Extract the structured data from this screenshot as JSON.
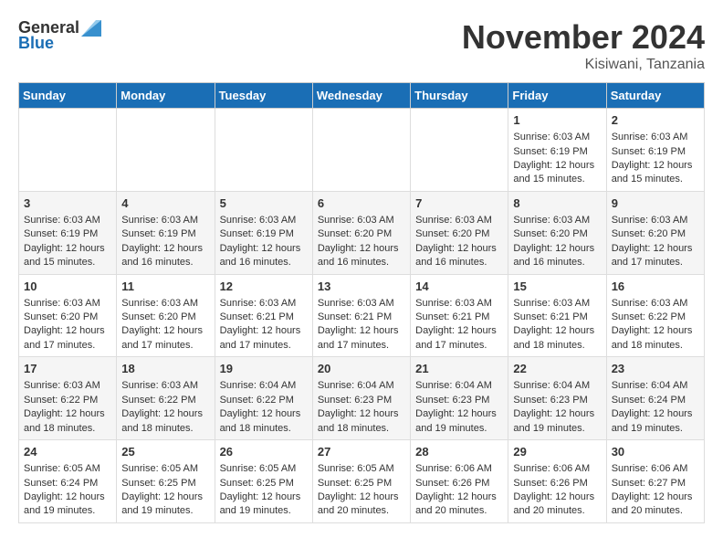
{
  "header": {
    "logo_general": "General",
    "logo_blue": "Blue",
    "month": "November 2024",
    "location": "Kisiwani, Tanzania"
  },
  "calendar": {
    "days_of_week": [
      "Sunday",
      "Monday",
      "Tuesday",
      "Wednesday",
      "Thursday",
      "Friday",
      "Saturday"
    ],
    "weeks": [
      [
        {
          "day": "",
          "info": ""
        },
        {
          "day": "",
          "info": ""
        },
        {
          "day": "",
          "info": ""
        },
        {
          "day": "",
          "info": ""
        },
        {
          "day": "",
          "info": ""
        },
        {
          "day": "1",
          "info": "Sunrise: 6:03 AM\nSunset: 6:19 PM\nDaylight: 12 hours\nand 15 minutes."
        },
        {
          "day": "2",
          "info": "Sunrise: 6:03 AM\nSunset: 6:19 PM\nDaylight: 12 hours\nand 15 minutes."
        }
      ],
      [
        {
          "day": "3",
          "info": "Sunrise: 6:03 AM\nSunset: 6:19 PM\nDaylight: 12 hours\nand 15 minutes."
        },
        {
          "day": "4",
          "info": "Sunrise: 6:03 AM\nSunset: 6:19 PM\nDaylight: 12 hours\nand 16 minutes."
        },
        {
          "day": "5",
          "info": "Sunrise: 6:03 AM\nSunset: 6:19 PM\nDaylight: 12 hours\nand 16 minutes."
        },
        {
          "day": "6",
          "info": "Sunrise: 6:03 AM\nSunset: 6:20 PM\nDaylight: 12 hours\nand 16 minutes."
        },
        {
          "day": "7",
          "info": "Sunrise: 6:03 AM\nSunset: 6:20 PM\nDaylight: 12 hours\nand 16 minutes."
        },
        {
          "day": "8",
          "info": "Sunrise: 6:03 AM\nSunset: 6:20 PM\nDaylight: 12 hours\nand 16 minutes."
        },
        {
          "day": "9",
          "info": "Sunrise: 6:03 AM\nSunset: 6:20 PM\nDaylight: 12 hours\nand 17 minutes."
        }
      ],
      [
        {
          "day": "10",
          "info": "Sunrise: 6:03 AM\nSunset: 6:20 PM\nDaylight: 12 hours\nand 17 minutes."
        },
        {
          "day": "11",
          "info": "Sunrise: 6:03 AM\nSunset: 6:20 PM\nDaylight: 12 hours\nand 17 minutes."
        },
        {
          "day": "12",
          "info": "Sunrise: 6:03 AM\nSunset: 6:21 PM\nDaylight: 12 hours\nand 17 minutes."
        },
        {
          "day": "13",
          "info": "Sunrise: 6:03 AM\nSunset: 6:21 PM\nDaylight: 12 hours\nand 17 minutes."
        },
        {
          "day": "14",
          "info": "Sunrise: 6:03 AM\nSunset: 6:21 PM\nDaylight: 12 hours\nand 17 minutes."
        },
        {
          "day": "15",
          "info": "Sunrise: 6:03 AM\nSunset: 6:21 PM\nDaylight: 12 hours\nand 18 minutes."
        },
        {
          "day": "16",
          "info": "Sunrise: 6:03 AM\nSunset: 6:22 PM\nDaylight: 12 hours\nand 18 minutes."
        }
      ],
      [
        {
          "day": "17",
          "info": "Sunrise: 6:03 AM\nSunset: 6:22 PM\nDaylight: 12 hours\nand 18 minutes."
        },
        {
          "day": "18",
          "info": "Sunrise: 6:03 AM\nSunset: 6:22 PM\nDaylight: 12 hours\nand 18 minutes."
        },
        {
          "day": "19",
          "info": "Sunrise: 6:04 AM\nSunset: 6:22 PM\nDaylight: 12 hours\nand 18 minutes."
        },
        {
          "day": "20",
          "info": "Sunrise: 6:04 AM\nSunset: 6:23 PM\nDaylight: 12 hours\nand 18 minutes."
        },
        {
          "day": "21",
          "info": "Sunrise: 6:04 AM\nSunset: 6:23 PM\nDaylight: 12 hours\nand 19 minutes."
        },
        {
          "day": "22",
          "info": "Sunrise: 6:04 AM\nSunset: 6:23 PM\nDaylight: 12 hours\nand 19 minutes."
        },
        {
          "day": "23",
          "info": "Sunrise: 6:04 AM\nSunset: 6:24 PM\nDaylight: 12 hours\nand 19 minutes."
        }
      ],
      [
        {
          "day": "24",
          "info": "Sunrise: 6:05 AM\nSunset: 6:24 PM\nDaylight: 12 hours\nand 19 minutes."
        },
        {
          "day": "25",
          "info": "Sunrise: 6:05 AM\nSunset: 6:25 PM\nDaylight: 12 hours\nand 19 minutes."
        },
        {
          "day": "26",
          "info": "Sunrise: 6:05 AM\nSunset: 6:25 PM\nDaylight: 12 hours\nand 19 minutes."
        },
        {
          "day": "27",
          "info": "Sunrise: 6:05 AM\nSunset: 6:25 PM\nDaylight: 12 hours\nand 20 minutes."
        },
        {
          "day": "28",
          "info": "Sunrise: 6:06 AM\nSunset: 6:26 PM\nDaylight: 12 hours\nand 20 minutes."
        },
        {
          "day": "29",
          "info": "Sunrise: 6:06 AM\nSunset: 6:26 PM\nDaylight: 12 hours\nand 20 minutes."
        },
        {
          "day": "30",
          "info": "Sunrise: 6:06 AM\nSunset: 6:27 PM\nDaylight: 12 hours\nand 20 minutes."
        }
      ]
    ]
  }
}
